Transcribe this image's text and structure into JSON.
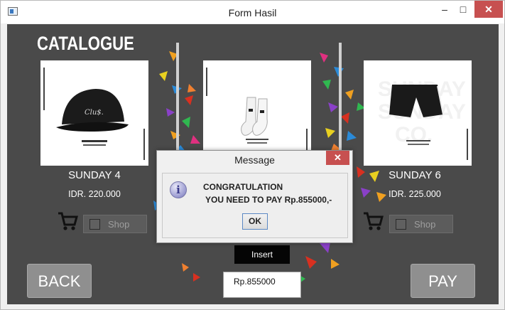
{
  "window": {
    "title": "Form Hasil",
    "minimize_glyph": "–",
    "maximize_glyph": "□",
    "close_glyph": "✕"
  },
  "catalogue_title": "CATALOGUE",
  "products": [
    {
      "name": "SUNDAY 4",
      "price": "IDR. 220.000",
      "shop_label": "Shop",
      "image": "black-cap-image"
    },
    {
      "name": "",
      "price": "",
      "shop_label": "",
      "image": "white-socks-image"
    },
    {
      "name": "SUNDAY 6",
      "price": "IDR. 225.000",
      "shop_label": "Shop",
      "image": "black-shorts-image"
    }
  ],
  "buttons": {
    "back": "BACK",
    "pay": "PAY",
    "insert": "Insert"
  },
  "total_field": {
    "value": "Rp.855000"
  },
  "dialog": {
    "title": "Message",
    "close_glyph": "✕",
    "line1": "CONGRATULATION",
    "line2": "YOU NEED TO PAY Rp.855000,-",
    "ok": "OK",
    "icon": "info-icon"
  },
  "colors": {
    "background": "#4a4a4a",
    "close_red": "#c75050",
    "button_gray": "#8f8f8f"
  }
}
